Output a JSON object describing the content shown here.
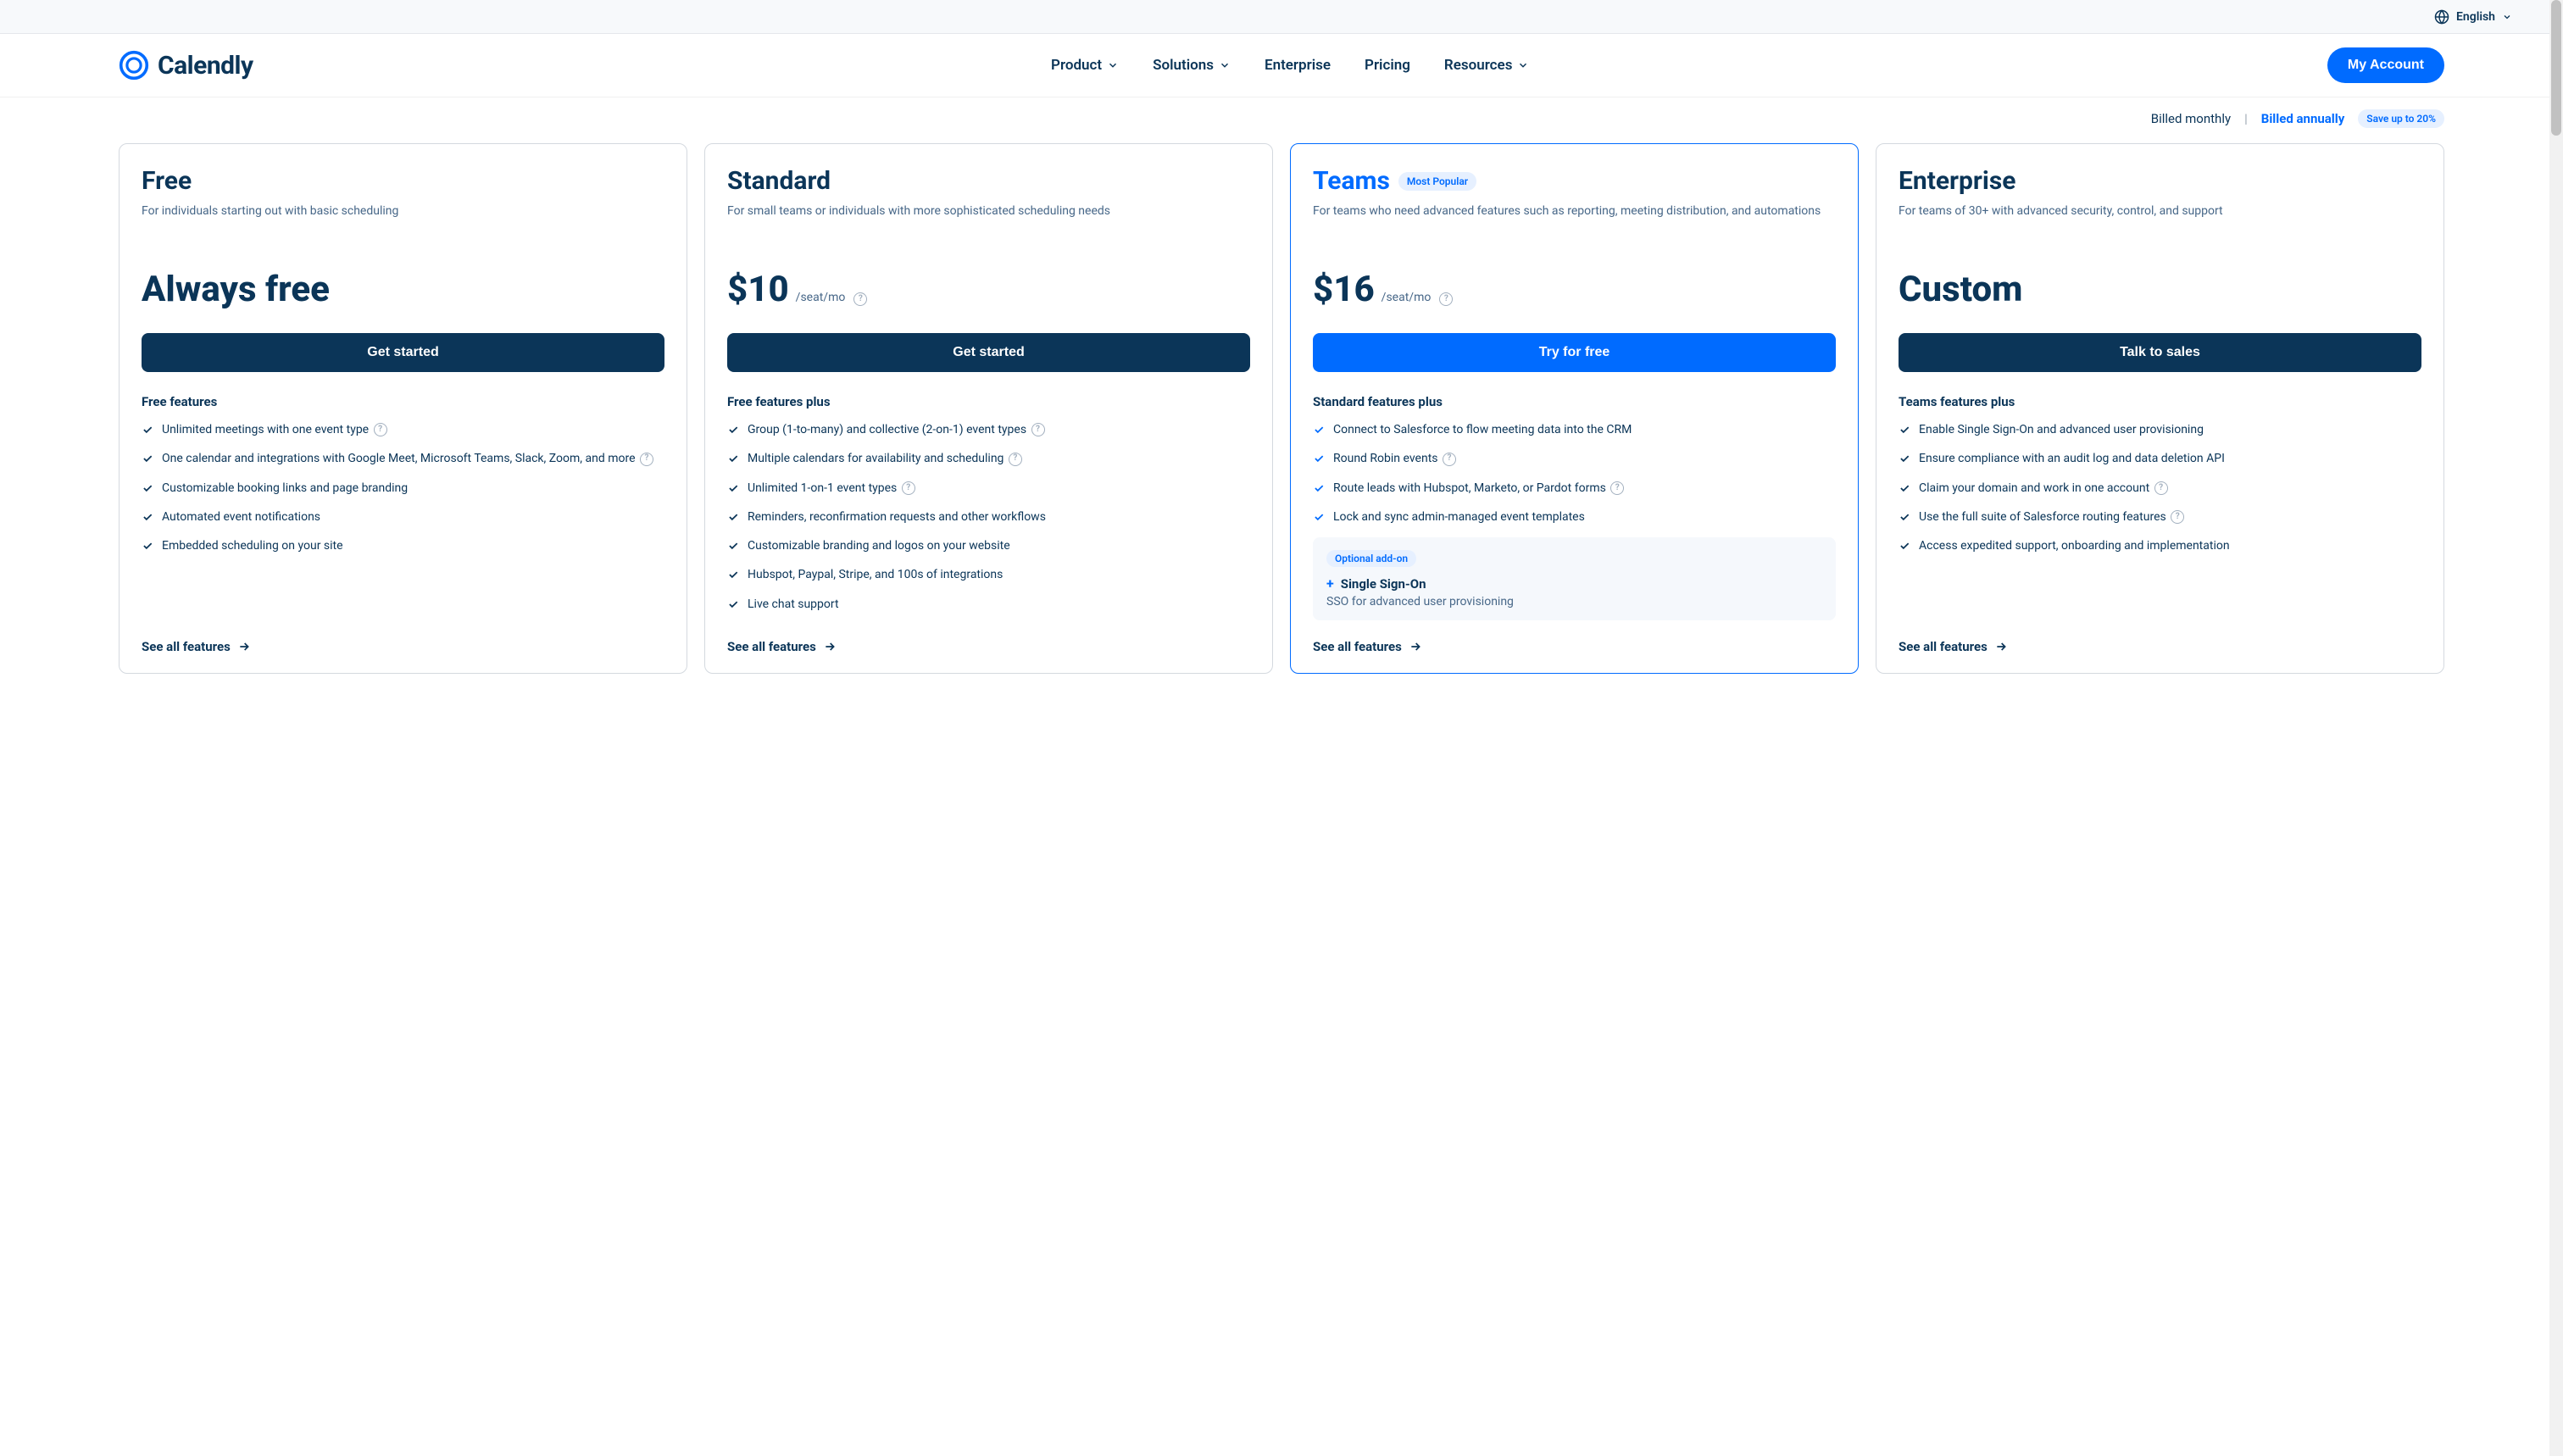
{
  "topbar": {
    "language": "English"
  },
  "nav": {
    "brand": "Calendly",
    "items": [
      "Product",
      "Solutions",
      "Enterprise",
      "Pricing",
      "Resources"
    ],
    "dropdown_flags": [
      true,
      true,
      false,
      false,
      true
    ],
    "account_btn": "My Account"
  },
  "billing": {
    "monthly": "Billed monthly",
    "annually": "Billed annually",
    "save_badge": "Save up to 20%"
  },
  "plans": [
    {
      "name": "Free",
      "desc": "For individuals starting out with basic scheduling",
      "price_label": "Always free",
      "price_amount": "",
      "price_unit": "",
      "cta": "Get started",
      "cta_style": "dark",
      "feat_head": "Free features",
      "features": [
        {
          "text": "Unlimited meetings with one event type",
          "info": true
        },
        {
          "text": "One calendar and integrations with Google Meet, Microsoft Teams, Slack, Zoom, and more",
          "info": true
        },
        {
          "text": "Customizable booking links and page branding",
          "info": false
        },
        {
          "text": "Automated event notifications",
          "info": false
        },
        {
          "text": "Embedded scheduling on your site",
          "info": false
        }
      ],
      "see_all": "See all features"
    },
    {
      "name": "Standard",
      "desc": "For small teams or individuals with more sophisticated scheduling needs",
      "price_label": "",
      "price_amount": "$10",
      "price_unit": "/seat/mo",
      "cta": "Get started",
      "cta_style": "dark",
      "feat_head": "Free features plus",
      "features": [
        {
          "text": "Group (1-to-many) and collective (2-on-1) event types",
          "info": true
        },
        {
          "text": "Multiple calendars for availability and scheduling",
          "info": true
        },
        {
          "text": "Unlimited 1-on-1 event types",
          "info": true
        },
        {
          "text": "Reminders, reconfirmation requests and other workflows",
          "info": false
        },
        {
          "text": "Customizable branding and logos on your website",
          "info": false
        },
        {
          "text": "Hubspot, Paypal, Stripe, and 100s of integrations",
          "info": false
        },
        {
          "text": "Live chat support",
          "info": false
        }
      ],
      "see_all": "See all features"
    },
    {
      "name": "Teams",
      "badge": "Most Popular",
      "desc": "For teams who need advanced features such as reporting, meeting distribution, and automations",
      "price_label": "",
      "price_amount": "$16",
      "price_unit": "/seat/mo",
      "cta": "Try for free",
      "cta_style": "blue",
      "highlight": true,
      "feat_head": "Standard features plus",
      "features": [
        {
          "text": "Connect to Salesforce to flow meeting data into the CRM",
          "info": false
        },
        {
          "text": "Round Robin events",
          "info": true
        },
        {
          "text": "Route leads with Hubspot, Marketo, or Pardot forms",
          "info": true
        },
        {
          "text": "Lock and sync admin-managed event templates",
          "info": false
        }
      ],
      "addon": {
        "pill": "Optional add-on",
        "title": "Single Sign-On",
        "desc": "SSO for advanced user provisioning"
      },
      "see_all": "See all features"
    },
    {
      "name": "Enterprise",
      "desc": "For teams of 30+ with advanced security, control, and support",
      "price_label": "Custom",
      "price_amount": "",
      "price_unit": "",
      "cta": "Talk to sales",
      "cta_style": "dark",
      "feat_head": "Teams features plus",
      "features": [
        {
          "text": "Enable Single Sign-On and advanced user provisioning",
          "info": false
        },
        {
          "text": "Ensure compliance with an audit log and data deletion API",
          "info": false
        },
        {
          "text": "Claim your domain and work in one account",
          "info": true
        },
        {
          "text": "Use the full suite of Salesforce routing features",
          "info": true
        },
        {
          "text": "Access expedited support, onboarding and implementation",
          "info": false
        }
      ],
      "see_all": "See all features"
    }
  ]
}
